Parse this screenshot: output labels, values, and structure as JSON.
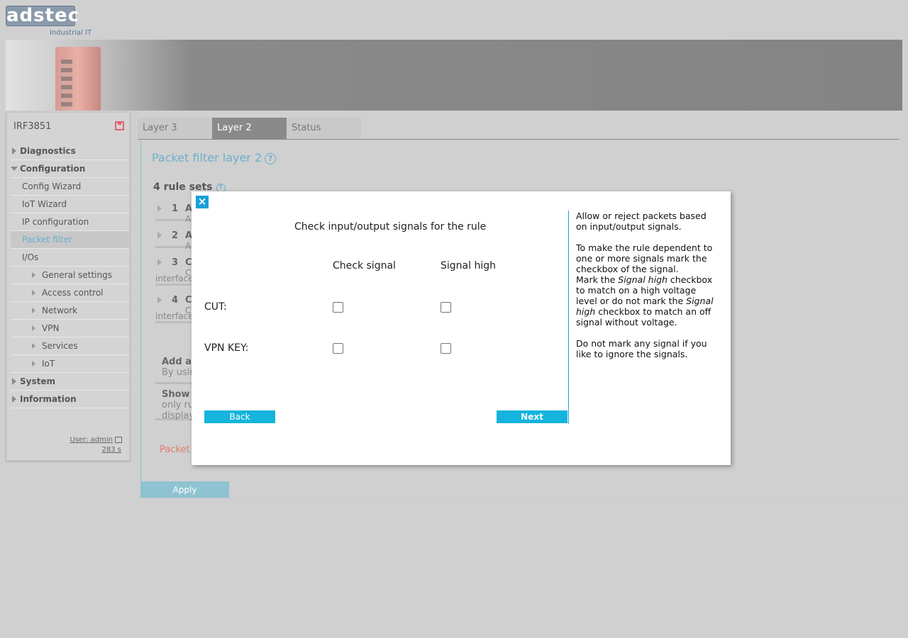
{
  "header": {
    "logo": "adstec",
    "logo_sub": "Industrial IT"
  },
  "sidebar": {
    "device_name": "IRF3851",
    "items": [
      {
        "label": "Diagnostics",
        "level": "top",
        "expanded": false
      },
      {
        "label": "Configuration",
        "level": "top",
        "expanded": true
      },
      {
        "label": "Config Wizard",
        "level": "sub"
      },
      {
        "label": "IoT Wizard",
        "level": "sub"
      },
      {
        "label": "IP configuration",
        "level": "sub"
      },
      {
        "label": "Packet filter",
        "level": "sub",
        "active": true
      },
      {
        "label": "I/Os",
        "level": "sub"
      },
      {
        "label": "General settings",
        "level": "subsub"
      },
      {
        "label": "Access control",
        "level": "subsub"
      },
      {
        "label": "Network",
        "level": "subsub"
      },
      {
        "label": "VPN",
        "level": "subsub"
      },
      {
        "label": "Services",
        "level": "subsub"
      },
      {
        "label": "IoT",
        "level": "subsub"
      },
      {
        "label": "System",
        "level": "top",
        "expanded": false
      },
      {
        "label": "Information",
        "level": "top",
        "expanded": false
      }
    ],
    "user": "User: admin",
    "timer": "283 s"
  },
  "tabs": [
    {
      "label": "Layer 3",
      "active": false
    },
    {
      "label": "Layer 2",
      "active": true
    },
    {
      "label": "Status",
      "active": false
    }
  ],
  "main": {
    "title": "Packet filter layer 2",
    "rules_heading": "4 rule sets",
    "rules": [
      {
        "num": "1",
        "letter": "A",
        "line2": "A",
        "iface": ""
      },
      {
        "num": "2",
        "letter": "A",
        "line2": "A",
        "iface": ""
      },
      {
        "num": "3",
        "letter": "C",
        "line2": "C",
        "iface": "interface"
      },
      {
        "num": "4",
        "letter": "C",
        "line2": "C",
        "iface": "interface"
      }
    ],
    "add_block": {
      "line1": "Add a",
      "line2": "By usin"
    },
    "show_block": {
      "line1": "Show",
      "line2": "only ru",
      "line3": "display"
    },
    "packet_text": "Packet",
    "apply_label": "Apply"
  },
  "modal": {
    "close_label": "×",
    "heading": "Check input/output signals for the rule",
    "col_check": "Check signal",
    "col_high": "Signal high",
    "rows": [
      {
        "label": "CUT:",
        "check": false,
        "high": false
      },
      {
        "label": "VPN KEY:",
        "check": false,
        "high": false
      }
    ],
    "back_label": "Back",
    "next_label": "Next",
    "help": {
      "p1": "Allow or reject packets based on input/output signals.",
      "p2a": "To make the rule dependent to one or more signals mark the checkbox of the signal.",
      "p2b_1": "Mark the ",
      "p2b_em1": "Signal high",
      "p2b_2": " checkbox to match on a high voltage level or do not mark the ",
      "p2b_em2": "Signal high",
      "p2b_3": " checkbox to match an off signal without voltage.",
      "p3": "Do not mark any signal if you like to ignore the signals."
    }
  }
}
